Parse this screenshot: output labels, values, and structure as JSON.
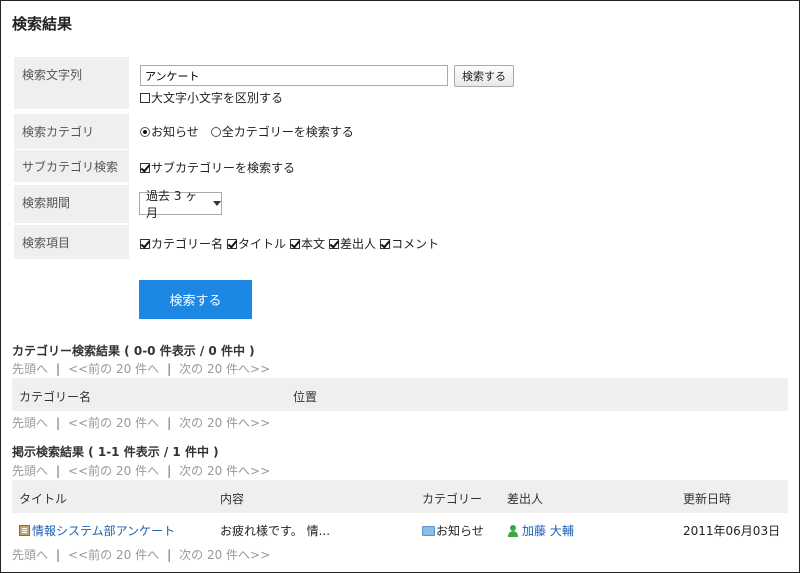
{
  "page_title": "検索結果",
  "form": {
    "keyword_label": "検索文字列",
    "keyword_value": "アンケート",
    "search_small_label": "検索する",
    "case_sensitive_label": "大文字小文字を区別する",
    "category_label": "検索カテゴリ",
    "category_radio_notice": "お知らせ",
    "category_radio_all": "全カテゴリーを検索する",
    "subcategory_label": "サブカテゴリ検索",
    "subcategory_checkbox": "サブカテゴリーを検索する",
    "period_label": "検索期間",
    "period_value": "過去 3 ヶ月",
    "items_label": "検索項目",
    "items": [
      "カテゴリー名",
      "タイトル",
      "本文",
      "差出人",
      "コメント"
    ],
    "search_button": "検索する"
  },
  "category_results": {
    "title": "カテゴリー検索結果 ( 0-0 件表示 / 0 件中 )",
    "pager_first": "先頭へ",
    "pager_prev": "<<前の 20 件へ",
    "pager_next": "次の 20 件へ>>",
    "pager_sep": "|",
    "columns": [
      "カテゴリー名",
      "位置"
    ]
  },
  "post_results": {
    "title": "掲示検索結果 ( 1-1 件表示 / 1 件中 )",
    "pager_first": "先頭へ",
    "pager_prev": "<<前の 20 件へ",
    "pager_next": "次の 20 件へ>>",
    "pager_sep": "|",
    "columns": [
      "タイトル",
      "内容",
      "カテゴリー",
      "差出人",
      "更新日時"
    ],
    "rows": [
      {
        "title": "情報システム部アンケート",
        "content": "お疲れ様です。 情...",
        "category": "お知らせ",
        "sender": "加藤 大輔",
        "updated": "2011年06月03日"
      }
    ]
  },
  "colors": {
    "primary_button": "#1d87e4",
    "link": "#1a5fb4",
    "label_bg": "#efefef",
    "pager_text": "#999999"
  }
}
